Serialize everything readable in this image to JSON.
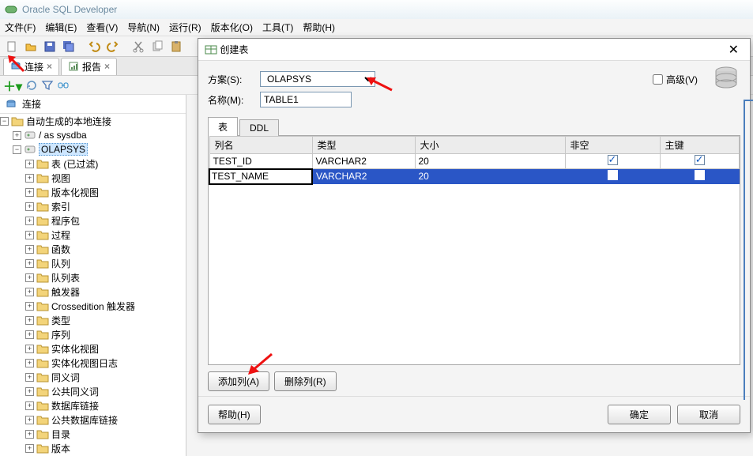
{
  "app": {
    "title": "Oracle SQL Developer"
  },
  "menu": {
    "file": "文件(F)",
    "edit": "编辑(E)",
    "view": "查看(V)",
    "nav": "导航(N)",
    "run": "运行(R)",
    "version": "版本化(O)",
    "tools": "工具(T)",
    "help": "帮助(H)"
  },
  "tabs": {
    "conn": "连接",
    "report": "报告"
  },
  "side": {
    "conn_header": "连接",
    "root": "自动生成的本地连接",
    "sysdba": "/ as sysdba",
    "schema": "OLAPSYS",
    "items": [
      "表 (已过滤)",
      "视图",
      "版本化视图",
      "索引",
      "程序包",
      "过程",
      "函数",
      "队列",
      "队列表",
      "触发器",
      "Crossedition 触发器",
      "类型",
      "序列",
      "实体化视图",
      "实体化视图日志",
      "同义词",
      "公共同义词",
      "数据库链接",
      "公共数据库链接",
      "目录",
      "版本"
    ]
  },
  "dialog": {
    "title": "创建表",
    "schema_label": "方案(S):",
    "schema_value": "OLAPSYS",
    "name_label": "名称(M):",
    "name_value": "TABLE1",
    "advanced": "高级(V)",
    "tab_table": "表",
    "tab_ddl": "DDL",
    "col_headers": {
      "name": "列名",
      "type": "类型",
      "size": "大小",
      "notnull": "非空",
      "pk": "主键"
    },
    "rows": [
      {
        "name": "TEST_ID",
        "type": "VARCHAR2",
        "size": "20",
        "notnull": true,
        "pk": true,
        "selected": false
      },
      {
        "name": "TEST_NAME",
        "type": "VARCHAR2",
        "size": "20",
        "notnull": false,
        "pk": false,
        "selected": true
      }
    ],
    "add_col": "添加列(A)",
    "del_col": "删除列(R)",
    "help": "帮助(H)",
    "ok": "确定",
    "cancel": "取消"
  }
}
